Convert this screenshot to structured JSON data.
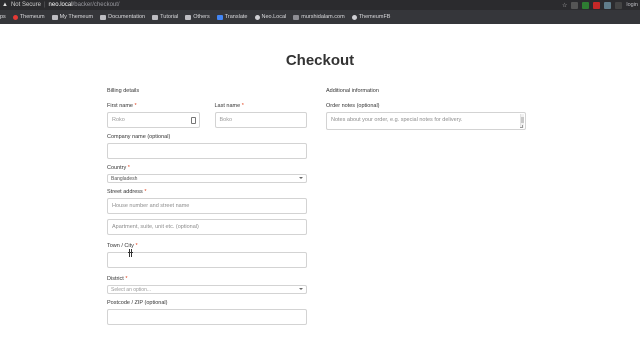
{
  "browser": {
    "security": "Not Secure",
    "host": "neo.local",
    "path": "/backer/checkout/",
    "profile": "login"
  },
  "bookmarks": [
    {
      "label": "ps",
      "icon": "apps-icon"
    },
    {
      "label": "Themeum",
      "icon": "themeum-icon"
    },
    {
      "label": "My Themeum",
      "icon": "folder-icon"
    },
    {
      "label": "Documentation",
      "icon": "folder-icon"
    },
    {
      "label": "Tutorial",
      "icon": "folder-icon"
    },
    {
      "label": "Others",
      "icon": "folder-icon"
    },
    {
      "label": "Translate",
      "icon": "translate-icon"
    },
    {
      "label": "Neo.Local",
      "icon": "page-icon"
    },
    {
      "label": "murshidalam.com",
      "icon": "page-icon"
    },
    {
      "label": "ThemeumFB",
      "icon": "facebook-icon"
    }
  ],
  "page": {
    "title": "Checkout"
  },
  "billing": {
    "heading": "Billing details",
    "first_name": {
      "label": "First name",
      "value": "Roko"
    },
    "last_name": {
      "label": "Last name",
      "value": "Boko"
    },
    "company": {
      "label": "Company name (optional)",
      "value": ""
    },
    "country": {
      "label": "Country",
      "value": "Bangladesh"
    },
    "street": {
      "label": "Street address",
      "placeholder1": "House number and street name",
      "placeholder2": "Apartment, suite, unit etc. (optional)"
    },
    "city": {
      "label": "Town / City",
      "value": ""
    },
    "district": {
      "label": "District",
      "placeholder": "Select an option..."
    },
    "postcode": {
      "label": "Postcode / ZIP (optional)",
      "value": ""
    },
    "required_mark": "*"
  },
  "additional": {
    "heading": "Additional information",
    "notes_label": "Order notes (optional)",
    "notes_placeholder": "Notes about your order, e.g. special notes for delivery."
  },
  "colors": {
    "required": "#e2401c",
    "chrome_dark": "#2b2b2e",
    "bookmarks_bar": "#35363a"
  }
}
